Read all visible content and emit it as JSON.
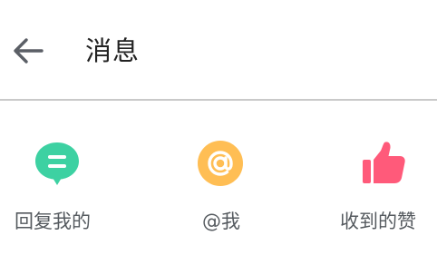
{
  "header": {
    "back_icon": "arrow-left-icon",
    "title": "消息"
  },
  "entries": [
    {
      "label": "回复我的",
      "icon": "chat-bubble-icon",
      "color": "#3dd1a2"
    },
    {
      "label": "@我",
      "icon": "at-sign-icon",
      "color": "#ffbe54"
    },
    {
      "label": "收到的赞",
      "icon": "thumbs-up-icon",
      "color": "#ff5a7a"
    }
  ],
  "colors": {
    "title": "#222222",
    "label": "#555a5f",
    "divider": "#c9c9c9",
    "back_arrow": "#5b5f66"
  }
}
